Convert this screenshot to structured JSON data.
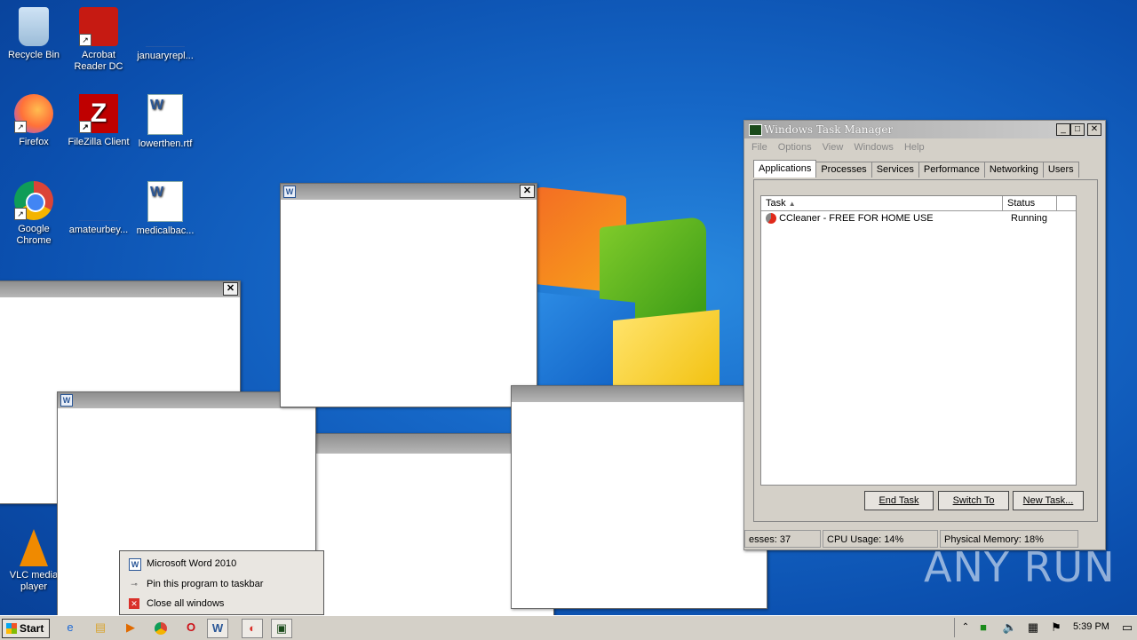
{
  "desktop": {
    "icons": [
      {
        "label": "Recycle Bin"
      },
      {
        "label": "Acrobat\nReader DC"
      },
      {
        "label": "januaryrepl..."
      },
      {
        "label": "Firefox"
      },
      {
        "label": "FileZilla Client"
      },
      {
        "label": "lowerthen.rtf"
      },
      {
        "label": "Google\nChrome"
      },
      {
        "label": "amateurbey..."
      },
      {
        "label": "medicalbac..."
      },
      {
        "label": "VLC media\nplayer"
      }
    ]
  },
  "taskmanager": {
    "title": "Windows Task Manager",
    "menu": [
      "File",
      "Options",
      "View",
      "Windows",
      "Help"
    ],
    "tabs": [
      "Applications",
      "Processes",
      "Services",
      "Performance",
      "Networking",
      "Users"
    ],
    "columns": [
      "Task",
      "Status"
    ],
    "rows": [
      {
        "task": "CCleaner - FREE FOR HOME USE",
        "status": "Running"
      }
    ],
    "buttons": {
      "end": "End Task",
      "switch": "Switch To",
      "new": "New Task..."
    },
    "status": {
      "processes": "esses: 37",
      "cpu": "CPU Usage: 14%",
      "memory": "Physical Memory: 18%"
    }
  },
  "jumplist": {
    "items": [
      {
        "label": "Microsoft Word 2010",
        "icon": "word-icon"
      },
      {
        "label": "Pin this program to taskbar",
        "icon": "pin-icon"
      },
      {
        "label": "Close all windows",
        "icon": "close-windows-icon"
      }
    ]
  },
  "taskbar": {
    "start": "Start",
    "clock": "5:39 PM"
  },
  "watermark": "ANY RUN"
}
